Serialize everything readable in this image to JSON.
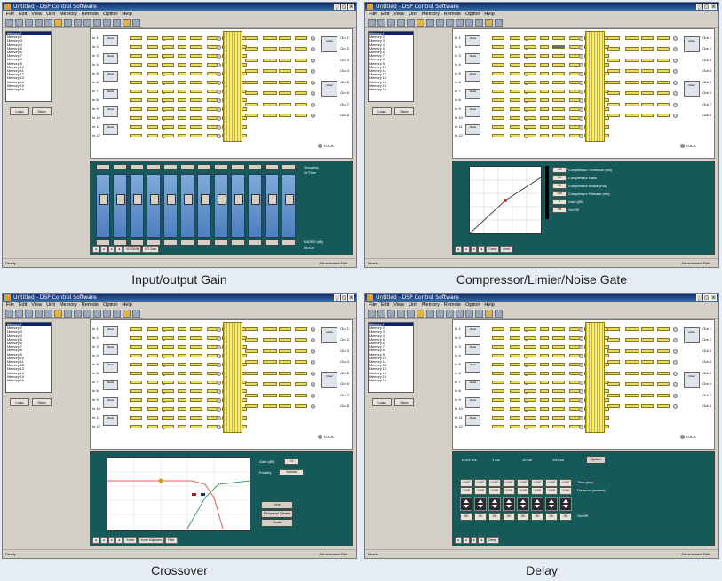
{
  "app": {
    "window_title": "Untitled - DSP Control Software",
    "menus": [
      "File",
      "Edit",
      "View",
      "Unit",
      "Memory",
      "Remote",
      "Option",
      "Help"
    ],
    "memory_items": [
      "Memory 1",
      "Memory 2",
      "Memory 3",
      "Memory 4",
      "Memory 5",
      "Memory 6",
      "Memory 7",
      "Memory 8",
      "Memory 9",
      "Memory 10",
      "Memory 11",
      "Memory 12",
      "Memory 13",
      "Memory 14",
      "Memory 15",
      "Memory 16"
    ],
    "load_button": "Load",
    "store_button": "Store",
    "inputs": [
      "In 1",
      "In 2",
      "In 3",
      "In 4",
      "In 5",
      "In 6",
      "In 7",
      "In 8",
      "In 9",
      "In 10",
      "In 11",
      "In 12"
    ],
    "outputs": [
      "Out 1",
      "Out 2",
      "Out 3",
      "Out 4",
      "Out 5",
      "Out 6",
      "Out 7",
      "Out 8"
    ],
    "lock_label": "LOCK",
    "status_ready": "Ready",
    "status_user": "Administrator  Edit",
    "grp_label": "Mask"
  },
  "panels": [
    {
      "caption": "Input/output Gain",
      "tabs": [
        "I/O GAIN",
        "I/O Gain"
      ],
      "right_labels": [
        "Grouping",
        "Gr Free"
      ],
      "footer_labels": [
        "FADER (dB)",
        "On/Off"
      ],
      "fader_value": "-10.0",
      "on_label": "On"
    },
    {
      "caption": "Compressor/Limier/Noise Gate",
      "tabs": [
        "Comp",
        "Limit"
      ],
      "params": [
        "Compressor Threshold (dB)",
        "Compressor Ratio",
        "Compressor Attack (ms)",
        "Compressor Release (ms)",
        "Gain (dB)",
        "On/Off"
      ],
      "param_values": [
        "-20",
        "3.0",
        "10",
        "100",
        "0",
        "Off"
      ]
    },
    {
      "caption": "Crossover",
      "tabs": [
        "Xover",
        "Xover Adjusted",
        "Filter"
      ],
      "gain_label": "Gain (dB)",
      "gain_value": "0.0",
      "polarity_label": "Polarity",
      "polarity_value": "Normal",
      "buttons": [
        "Link",
        "Response Viewer",
        "Scale"
      ]
    },
    {
      "caption": "Delay",
      "tabs": [
        "Delay"
      ],
      "units": [
        "0.021 ms",
        "1 ms",
        "10 ms",
        "100 ms"
      ],
      "option_button": "Option",
      "param_labels": [
        "Time (ms)",
        "Distance (meters)",
        "On/Off"
      ],
      "time_value": "0.000",
      "on_label": "On"
    }
  ]
}
